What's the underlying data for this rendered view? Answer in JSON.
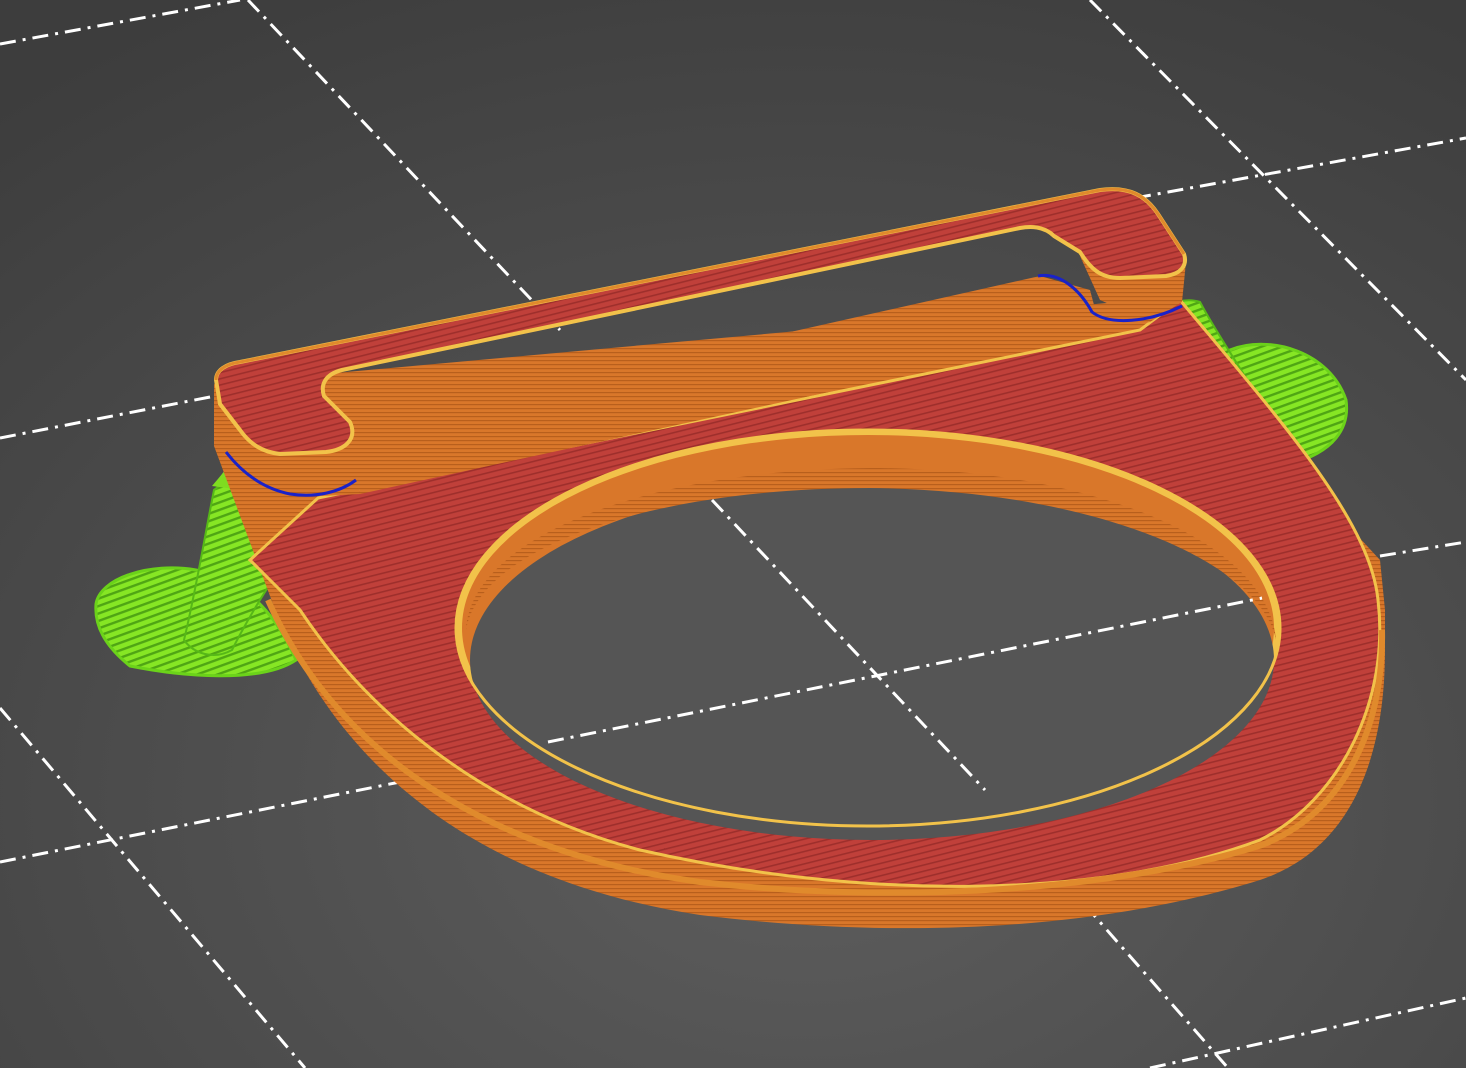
{
  "viewport": {
    "view": "gcode-preview-3d",
    "background_color": "#4d4d4d",
    "grid_line_color": "#ffffff",
    "grid_line_style": "dash-dot"
  },
  "model": {
    "shape": "flat-plate-with-circular-hole-and-raised-back-bracket",
    "feature_colors": {
      "external_perimeter": "#e0781e",
      "perimeter": "#f2c24a",
      "solid_infill": "#b83a3a",
      "top_solid_infill": "#c8453c",
      "support_material": "#7fe01c",
      "overhang_perimeter": "#1a22c8"
    },
    "supports": {
      "count": 2,
      "color": "#7fe01c"
    }
  }
}
